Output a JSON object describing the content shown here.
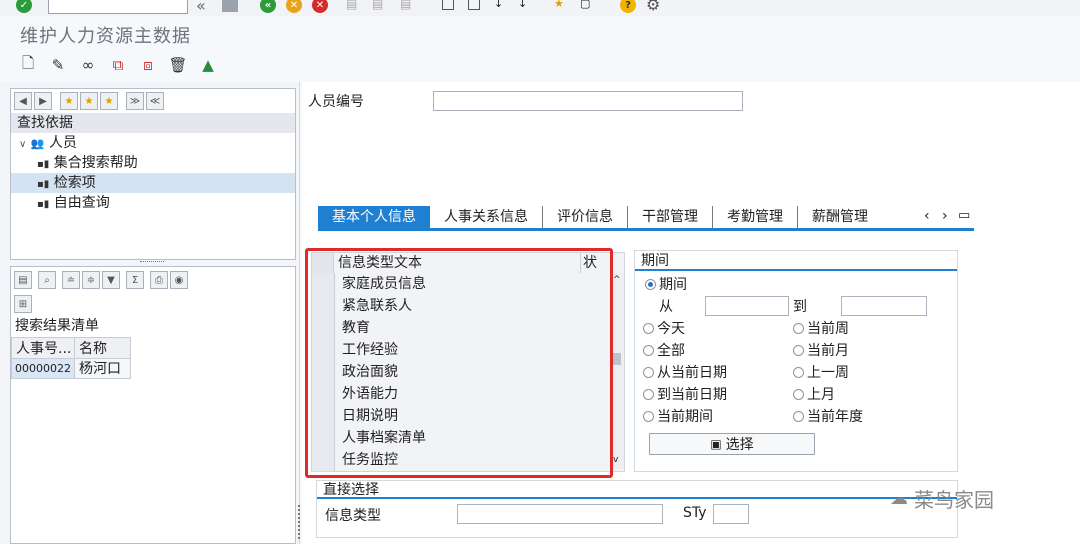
{
  "window": {
    "title": "维护人力资源主数据"
  },
  "system_toolbar": {
    "command_value": ""
  },
  "nav": {
    "find_by_label": "查找依据",
    "tree": [
      {
        "label": "人员"
      },
      {
        "label": "集合搜索帮助"
      },
      {
        "label": "检索项"
      },
      {
        "label": "自由查询"
      }
    ]
  },
  "results": {
    "title": "搜索结果清单",
    "columns": [
      "人事号...",
      "名称"
    ],
    "rows": [
      {
        "id": "00000022",
        "name": "杨河口"
      }
    ]
  },
  "header": {
    "personnel_no_label": "人员编号",
    "personnel_no_value": ""
  },
  "tabs": [
    "基本个人信息",
    "人事关系信息",
    "评价信息",
    "干部管理",
    "考勤管理",
    "薪酬管理"
  ],
  "infotypes": {
    "col_text": "信息类型文本",
    "col_status": "状",
    "rows": [
      "家庭成员信息",
      "紧急联系人",
      "教育",
      "工作经验",
      "政治面貌",
      "外语能力",
      "日期说明",
      "人事档案清单",
      "任务监控"
    ]
  },
  "period": {
    "title": "期间",
    "period_option": "期间",
    "from_label": "从",
    "to_label": "到",
    "options_left": [
      "今天",
      "全部",
      "从当前日期",
      "到当前日期",
      "当前期间"
    ],
    "options_right": [
      "当前周",
      "当前月",
      "上一周",
      "上月",
      "当前年度"
    ],
    "select_button": "选择"
  },
  "direct": {
    "title": "直接选择",
    "infotype_label": "信息类型",
    "sty_label": "STy"
  },
  "watermark": {
    "text": "菜鸟家园"
  },
  "colors": {
    "accent": "#1f7fd1",
    "highlight": "#e02a27"
  }
}
